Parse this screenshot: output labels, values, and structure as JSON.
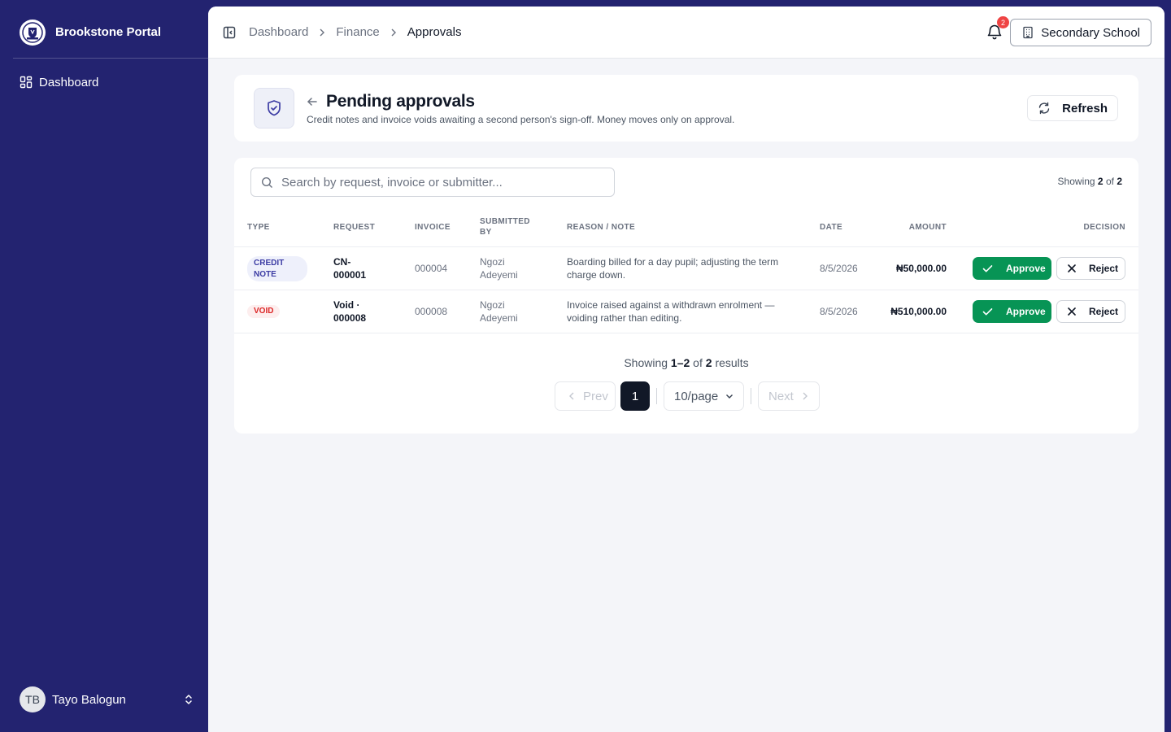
{
  "sidebar": {
    "brand": "Brookstone Portal",
    "nav": [
      {
        "label": "Dashboard",
        "icon": "dashboard-grid-icon"
      }
    ],
    "user": {
      "initials": "TB",
      "name": "Tayo Balogun"
    }
  },
  "topbar": {
    "breadcrumbs": [
      "Dashboard",
      "Finance",
      "Approvals"
    ],
    "notifications_count": "2",
    "school": "Secondary School"
  },
  "page": {
    "title": "Pending approvals",
    "subtitle": "Credit notes and invoice voids awaiting a second person's sign-off. Money moves only on approval.",
    "refresh_label": "Refresh"
  },
  "search": {
    "placeholder": "Search by request, invoice or submitter..."
  },
  "showing": {
    "prefix": "Showing",
    "count": "2",
    "of": "of",
    "total": "2"
  },
  "table": {
    "columns": [
      "Type",
      "Request",
      "Invoice",
      "Submitted by",
      "Reason / Note",
      "Date",
      "Amount",
      "Decision"
    ],
    "rows": [
      {
        "type": "CREDIT NOTE",
        "request": "CN-000001",
        "invoice": "000004",
        "submitted_by": "Ngozi Adeyemi",
        "note": "Boarding billed for a day pupil; adjusting the term charge down.",
        "date": "8/5/2026",
        "amount": "₦50,000.00",
        "approve": "Approve",
        "reject": "Reject"
      },
      {
        "type": "VOID",
        "request": "Void · 000008",
        "invoice": "000008",
        "submitted_by": "Ngozi Adeyemi",
        "note": "Invoice raised against a withdrawn enrolment — voiding rather than editing.",
        "date": "8/5/2026",
        "amount": "₦510,000.00",
        "approve": "Approve",
        "reject": "Reject"
      }
    ]
  },
  "pagination": {
    "showing_prefix": "Showing",
    "range": "1–2",
    "of": "of",
    "total": "2",
    "suffix": "results",
    "prev": "Prev",
    "current_page": "1",
    "per_page": "10/page",
    "next": "Next"
  },
  "colors": {
    "sidebar": "#232370",
    "approve": "#079455",
    "badge": "#ef4444",
    "void_text": "#dc2626",
    "credit_text": "#3b3ba3"
  }
}
